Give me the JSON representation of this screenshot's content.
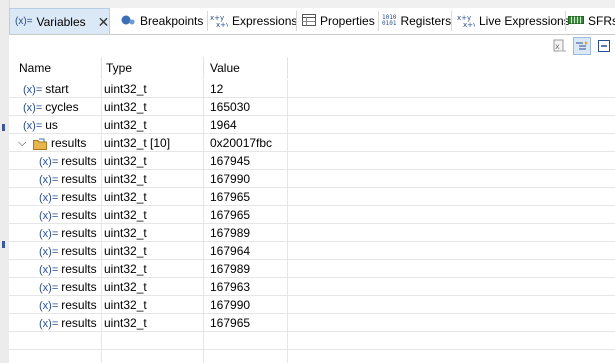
{
  "tabs": [
    {
      "label": "Variables",
      "icon": "variables-icon",
      "active": true
    },
    {
      "label": "Breakpoints",
      "icon": "breakpoints-icon"
    },
    {
      "label": "Expressions",
      "icon": "expressions-icon"
    },
    {
      "label": "Properties",
      "icon": "properties-icon"
    },
    {
      "label": "Registers",
      "icon": "registers-icon"
    },
    {
      "label": "Live Expressions",
      "icon": "live-expressions-icon"
    },
    {
      "label": "SFRs",
      "icon": "sfrs-icon"
    }
  ],
  "tab_icon_text": {
    "variables": "(x)=",
    "registers_top": "1010",
    "registers_bottom": "0101"
  },
  "table": {
    "columns": [
      "Name",
      "Type",
      "Value"
    ],
    "rows": [
      {
        "name": "start",
        "type": "uint32_t",
        "value": "12"
      },
      {
        "name": "cycles",
        "type": "uint32_t",
        "value": "165030"
      },
      {
        "name": "us",
        "type": "uint32_t",
        "value": "1964"
      },
      {
        "name": "results",
        "type": "uint32_t [10]",
        "value": "0x20017fbc",
        "expanded": true
      },
      {
        "name": "results",
        "type": "uint32_t",
        "value": "167945"
      },
      {
        "name": "results",
        "type": "uint32_t",
        "value": "167990"
      },
      {
        "name": "results",
        "type": "uint32_t",
        "value": "167965"
      },
      {
        "name": "results",
        "type": "uint32_t",
        "value": "167965"
      },
      {
        "name": "results",
        "type": "uint32_t",
        "value": "167989"
      },
      {
        "name": "results",
        "type": "uint32_t",
        "value": "167964"
      },
      {
        "name": "results",
        "type": "uint32_t",
        "value": "167989"
      },
      {
        "name": "results",
        "type": "uint32_t",
        "value": "167963"
      },
      {
        "name": "results",
        "type": "uint32_t",
        "value": "167990"
      },
      {
        "name": "results",
        "type": "uint32_t",
        "value": "167965"
      }
    ]
  },
  "toolbar": {
    "buttons": [
      "show-type-names-icon",
      "collapse-all-icon",
      "minimize-icon"
    ]
  },
  "colors": {
    "active_tab": "#dbe8f6",
    "var_icon": "#2a4d8f",
    "folder": "#e8b64c",
    "grid": "#e6e6e6"
  }
}
